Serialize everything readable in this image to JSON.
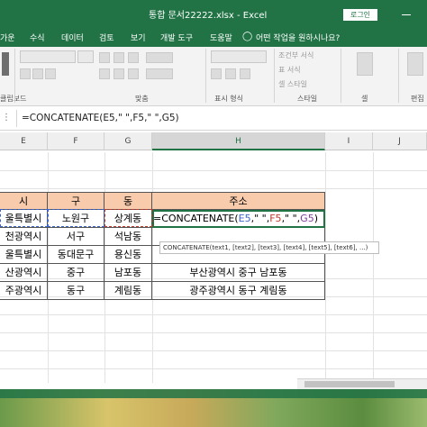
{
  "window": {
    "title": "통합 문서22222.xlsx  -  Excel",
    "login_label": "로그인"
  },
  "menu": {
    "items": [
      "가운",
      "수식",
      "데이터",
      "검토",
      "보기",
      "개발 도구",
      "도움말"
    ],
    "tell_me": "어떤 작업을 원하시나요?"
  },
  "ribbon": {
    "groups": [
      "클립보드",
      "맞춤",
      "표시 형식",
      "스타일",
      "셀",
      "편집"
    ],
    "conditional_format": "조건부 서식",
    "table_format": "표 서식",
    "cell_style": "셀 스타일",
    "cell_label": "셀"
  },
  "formula_bar": {
    "formula": "=CONCATENATE(E5,\" \",F5,\" \",G5)"
  },
  "columns": [
    "E",
    "F",
    "G",
    "H",
    "I",
    "J"
  ],
  "table": {
    "headers": [
      "시",
      "구",
      "동",
      "주소"
    ],
    "rows": [
      [
        "울특별시",
        "노원구",
        "상계동",
        ""
      ],
      [
        "천광역시",
        "서구",
        "석남동",
        ""
      ],
      [
        "울특별시",
        "동대문구",
        "용신동",
        ""
      ],
      [
        "산광역시",
        "중구",
        "남포동",
        "부산광역시 중구 남포동"
      ],
      [
        "주광역시",
        "동구",
        "계림동",
        "광주광역시 동구 계림동"
      ]
    ]
  },
  "active_cell_formula": {
    "prefix": "=CONCATENATE(",
    "ref1": "E5",
    "sep1": ",\" \",",
    "ref2": "F5",
    "sep2": ",\" \",",
    "ref3": "G5",
    "suffix": ")"
  },
  "tooltip": "CONCATENATE(text1, [text2], [text3], [text4], [text5], [text6], ...)",
  "colors": {
    "accent": "#217346",
    "header_fill": "#f8cbad"
  }
}
